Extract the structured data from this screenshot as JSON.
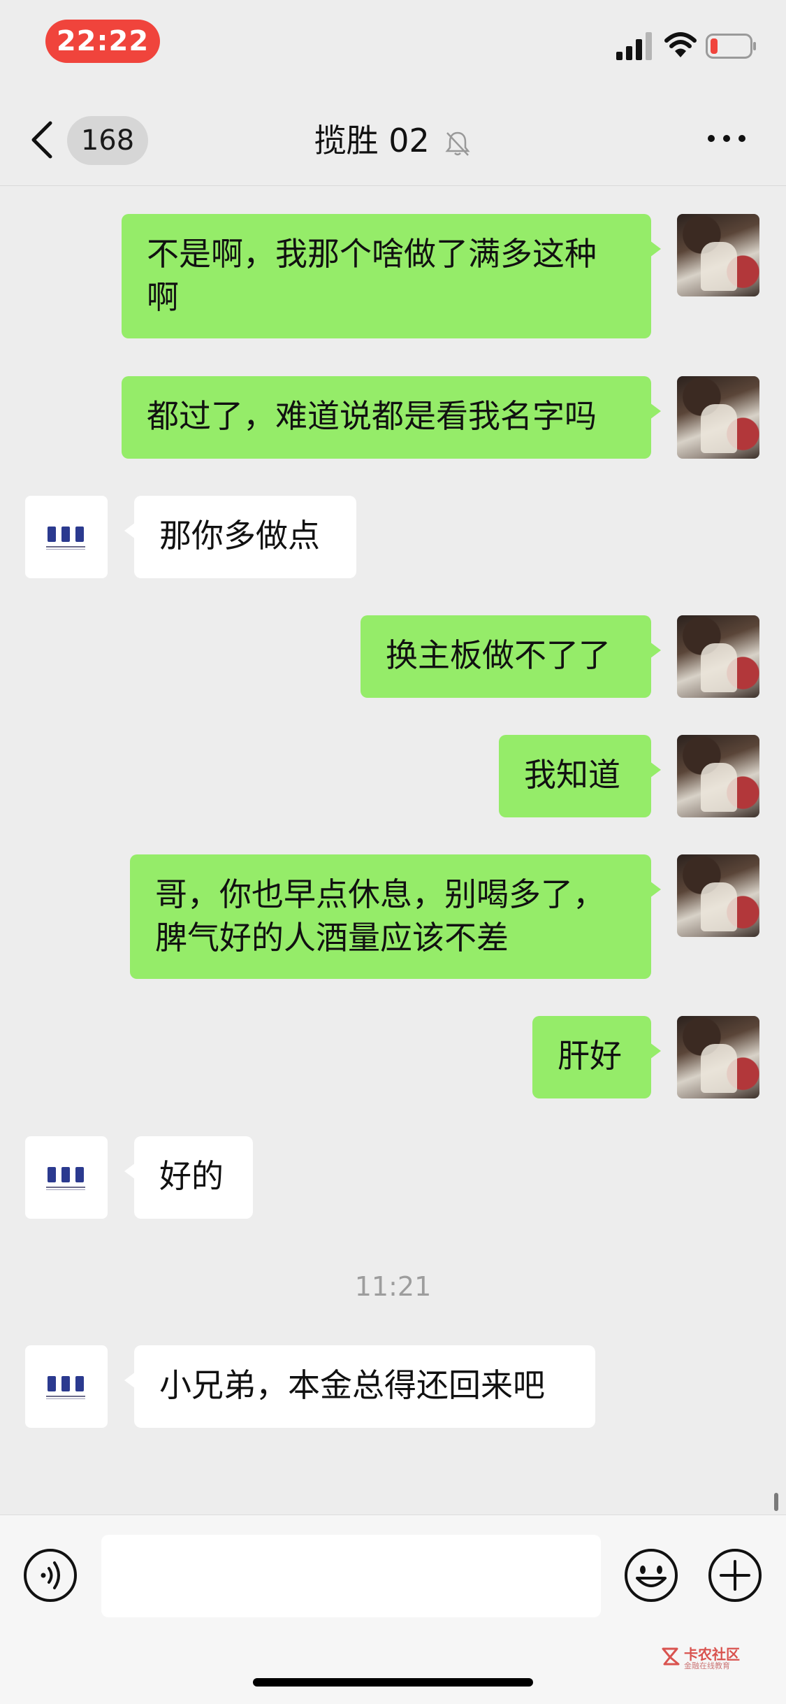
{
  "status_bar": {
    "time": "22:22"
  },
  "nav": {
    "unread_count": "168",
    "title": "揽胜 02",
    "icons": [
      "back-chevron-icon",
      "bell-muted-icon",
      "more-dots-icon"
    ]
  },
  "messages": [
    {
      "side": "out",
      "text": "不是啊，我那个啥做了满多这种啊"
    },
    {
      "side": "out",
      "text": "都过了，难道说都是看我名字吗"
    },
    {
      "side": "in",
      "text": "那你多做点"
    },
    {
      "side": "out",
      "text": "换主板做不了了"
    },
    {
      "side": "out",
      "text": "我知道"
    },
    {
      "side": "out",
      "text": "哥，你也早点休息，别喝多了，脾气好的人酒量应该不差"
    },
    {
      "side": "out",
      "text": "肝好"
    },
    {
      "side": "in",
      "text": "好的"
    },
    {
      "side": "in",
      "text": "小兄弟，本金总得还回来吧"
    }
  ],
  "timestamp": "11:21",
  "input_bar": {
    "value": "",
    "icons": [
      "voice-icon",
      "emoji-icon",
      "plus-icon"
    ]
  },
  "watermark": {
    "main": "卡农社区",
    "sub": "金融在线教育"
  },
  "colors": {
    "time_pill": "#f0443c",
    "outgoing_bubble": "#95ec69",
    "incoming_bubble": "#ffffff",
    "background": "#ededed"
  }
}
